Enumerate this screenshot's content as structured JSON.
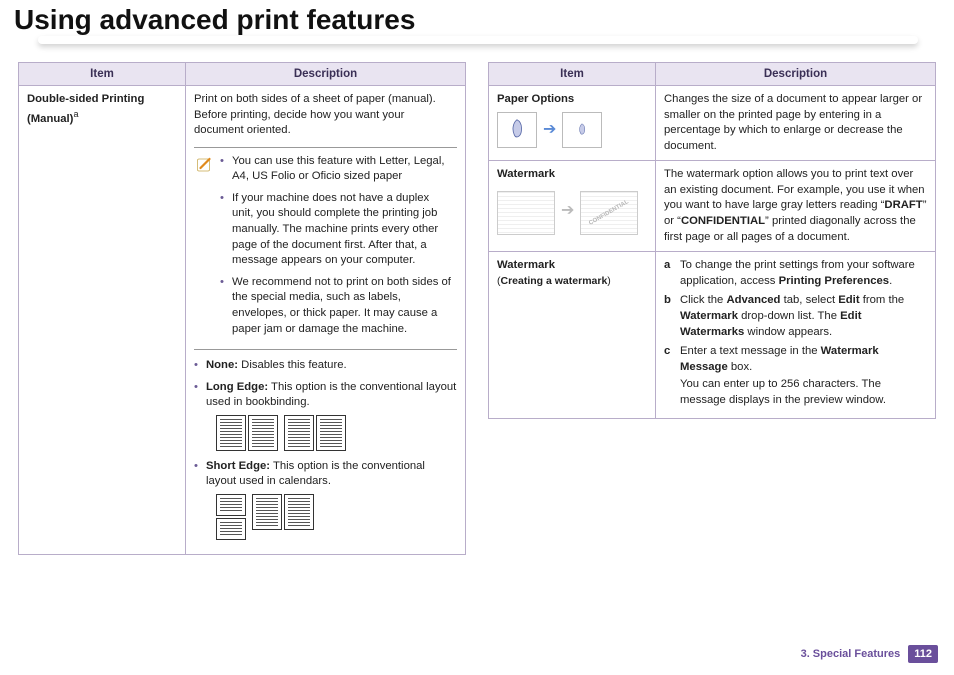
{
  "title": "Using advanced print features",
  "columns": {
    "header": {
      "item": "Item",
      "desc": "Description"
    }
  },
  "leftRow": {
    "item_main": "Double-sided Printing",
    "item_sub": "(Manual)",
    "item_sup": "a",
    "intro": "Print on both sides of a sheet of paper (manual). Before printing, decide how you want your document oriented.",
    "notes": [
      "You can use this feature with Letter, Legal, A4, US Folio or Oficio sized paper",
      "If your machine does not have a duplex unit, you should complete the printing job manually. The machine prints every other page of the document first. After that, a message appears on your computer.",
      "We recommend not to print on both sides of the special media, such as labels, envelopes, or thick paper. It may cause a paper jam or damage the machine."
    ],
    "options": {
      "none_label": "None:",
      "none_text": " Disables this feature.",
      "long_label": "Long Edge:",
      "long_text": " This option is the conventional layout used in bookbinding.",
      "short_label": "Short Edge:",
      "short_text": " This option is the conventional layout used in calendars."
    }
  },
  "rightRows": {
    "paper": {
      "item": "Paper Options",
      "desc": "Changes the size of a document to appear larger or smaller on the printed page by entering in a percentage by which to enlarge or decrease the document."
    },
    "wm": {
      "item": "Watermark",
      "desc_pre": "The watermark option allows you to print text over an existing document. For example, you use it when you want to have large gray letters reading “",
      "draft": "DRAFT",
      "mid": "” or “",
      "conf": "CONFIDENTIAL",
      "desc_post": "” printed diagonally across the first page or all pages of a document.",
      "thumb_text": "CONFIDENTIAL"
    },
    "create": {
      "item": "Watermark",
      "item_sub": "(Creating a watermark)",
      "a_pre": "To change the print settings from your software application, access ",
      "a_bold": "Printing Preferences",
      "a_post": ".",
      "b_pre": "Click the ",
      "b_adv": "Advanced",
      "b_mid1": " tab, select ",
      "b_edit": "Edit",
      "b_mid2": " from the ",
      "b_wm": "Watermark",
      "b_mid3": " drop-down list. The ",
      "b_ew": "Edit Watermarks",
      "b_post": " window appears.",
      "c_pre": "Enter a text message in the ",
      "c_box": "Watermark Message",
      "c_post": " box.",
      "c_extra": "You can enter up to 256 characters. The message displays in the preview window."
    }
  },
  "footer": {
    "chapter": "3.  Special Features",
    "page": "112"
  }
}
